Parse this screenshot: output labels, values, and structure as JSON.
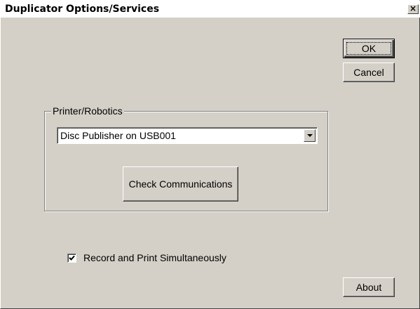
{
  "window": {
    "title": "Duplicator Options/Services",
    "close_glyph": "×"
  },
  "buttons": {
    "ok_label": "OK",
    "cancel_label": "Cancel",
    "check_comm_label": "Check Communications",
    "about_label": "About"
  },
  "printer_group": {
    "legend": "Printer/Robotics",
    "selected_printer": "Disc Publisher on USB001"
  },
  "options": {
    "record_print_label": "Record and Print Simultaneously",
    "record_print_checked": true
  },
  "colors": {
    "face": "#d4d0c8",
    "title_bg": "#ffffff"
  }
}
